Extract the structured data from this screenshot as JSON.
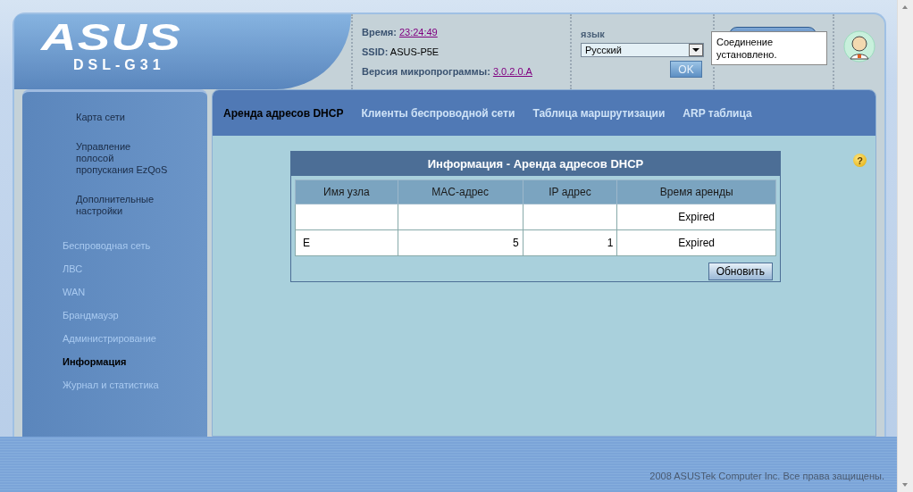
{
  "header": {
    "logo": "ASUS",
    "model": "DSL-G31",
    "time_label": "Время:",
    "time": "23:24:49",
    "ssid_label": "SSID:",
    "ssid": "ASUS-P5E",
    "firmware_label": "Версия микропрограммы:",
    "firmware": "3.0.2.0.A",
    "language_label": "язык",
    "language": "Русский",
    "ok_button": "OK",
    "tooltip": "Соединение установлено."
  },
  "sidebar": {
    "items": [
      {
        "label": "Карта сети",
        "kind": "top",
        "selected": false
      },
      {
        "label": "Управление полосой пропускания EzQoS",
        "kind": "top",
        "selected": false
      },
      {
        "label": "Дополнительные настройки",
        "kind": "top",
        "selected": false
      },
      {
        "label": "Беспроводная сеть",
        "kind": "section",
        "selected": false
      },
      {
        "label": "ЛВС",
        "kind": "section",
        "selected": false
      },
      {
        "label": "WAN",
        "kind": "section",
        "selected": false
      },
      {
        "label": "Брандмауэр",
        "kind": "section",
        "selected": false
      },
      {
        "label": "Администрирование",
        "kind": "section",
        "selected": false
      },
      {
        "label": "Информация",
        "kind": "section",
        "selected": true
      },
      {
        "label": "Журнал и статистика",
        "kind": "section",
        "selected": false
      }
    ]
  },
  "tabs": [
    {
      "label": "Аренда адресов DHCP",
      "selected": true
    },
    {
      "label": "Клиенты беспроводной сети",
      "selected": false
    },
    {
      "label": "Таблица маршрутизации",
      "selected": false
    },
    {
      "label": "ARP таблица",
      "selected": false
    }
  ],
  "help": "?",
  "table": {
    "title": "Информация - Аренда адресов DHCP",
    "columns": [
      "Имя узла",
      "MAC-адрес",
      "IP адрес",
      "Время аренды"
    ],
    "rows": [
      {
        "lease": "Expired"
      },
      {
        "host": "E",
        "mac": "5",
        "ip": "1",
        "lease": "Expired"
      }
    ],
    "refresh_button": "Обновить"
  },
  "footer": "2008 ASUSTek Computer Inc. Все права защищены."
}
